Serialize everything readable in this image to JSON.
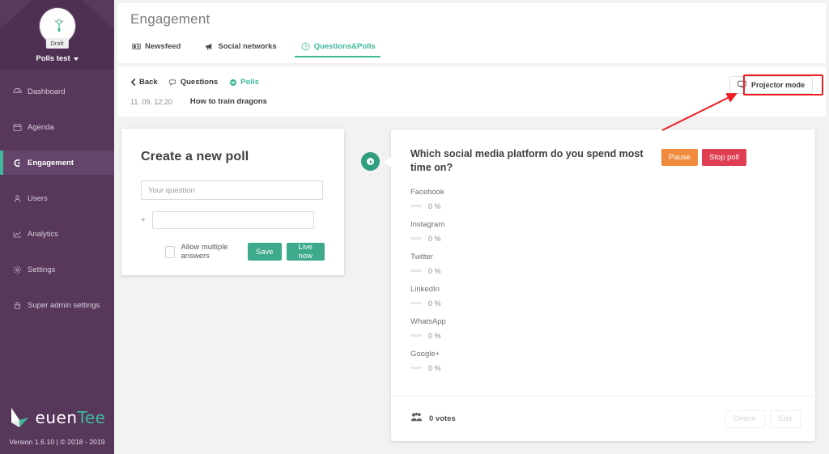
{
  "sidebar": {
    "avatar_icon": "event-avatar-icon",
    "draft_badge": "Draft",
    "event_name": "Polls test",
    "items": [
      {
        "label": "Dashboard",
        "icon": "dashboard-icon",
        "active": false
      },
      {
        "label": "Agenda",
        "icon": "calendar-icon",
        "active": false
      },
      {
        "label": "Engagement",
        "icon": "engagement-icon",
        "active": true
      },
      {
        "label": "Users",
        "icon": "users-icon",
        "active": false
      },
      {
        "label": "Analytics",
        "icon": "analytics-chart-icon",
        "active": false
      },
      {
        "label": "Settings",
        "icon": "gear-icon",
        "active": false
      },
      {
        "label": "Super admin settings",
        "icon": "lock-icon",
        "active": false
      }
    ],
    "brand_part1": "euen",
    "brand_part2": "Tee",
    "version": "Version 1.6.10 | © 2018 - 2019"
  },
  "header": {
    "title": "Engagement",
    "tabs": [
      {
        "label": "Newsfeed",
        "icon": "newspaper-icon",
        "active": false
      },
      {
        "label": "Social networks",
        "icon": "megaphone-icon",
        "active": false
      },
      {
        "label": "Questions&Polls",
        "icon": "question-circle-icon",
        "active": true
      }
    ]
  },
  "subbar": {
    "back_label": "Back",
    "questions_label": "Questions",
    "polls_label": "Polls",
    "session_time": "11. 09. 12:20",
    "session_title": "How to train dragons",
    "projector_label": "Projector mode",
    "projector_icon": "monitor-icon"
  },
  "create_poll": {
    "title": "Create a new poll",
    "question_placeholder": "Your question",
    "question_value": "",
    "option_placeholder": "",
    "option_value": "",
    "add_option_icon": "plus-icon",
    "allow_multiple_label": "Allow multiple answers",
    "allow_multiple_checked": false,
    "save_label": "Save",
    "live_now_label": "Live now"
  },
  "poll": {
    "status_icon": "live-play-icon",
    "question": "Which social media platform do you spend most time on?",
    "pause_label": "Pause",
    "stop_label": "Stop poll",
    "votes_icon": "people-icon",
    "votes_label": "0 votes",
    "delete_label": "Delete",
    "edit_label": "Edit",
    "options": [
      {
        "name": "Facebook",
        "percent": "0 %"
      },
      {
        "name": "Instagram",
        "percent": "0 %"
      },
      {
        "name": "Twitter",
        "percent": "0 %"
      },
      {
        "name": "LinkedIn",
        "percent": "0 %"
      },
      {
        "name": "WhatsApp",
        "percent": "0 %"
      },
      {
        "name": "Google+",
        "percent": "0 %"
      }
    ]
  },
  "annotation": {
    "highlight_color": "#ef1c22",
    "target": "Projector mode"
  },
  "colors": {
    "sidebar_bg": "#57385a",
    "sidebar_active": "#64446a",
    "accent_green": "#3fb99a",
    "button_green": "#3daa8c",
    "orange": "#f08a3c",
    "red": "#e03e52",
    "page_bg": "#f2f2f2"
  }
}
